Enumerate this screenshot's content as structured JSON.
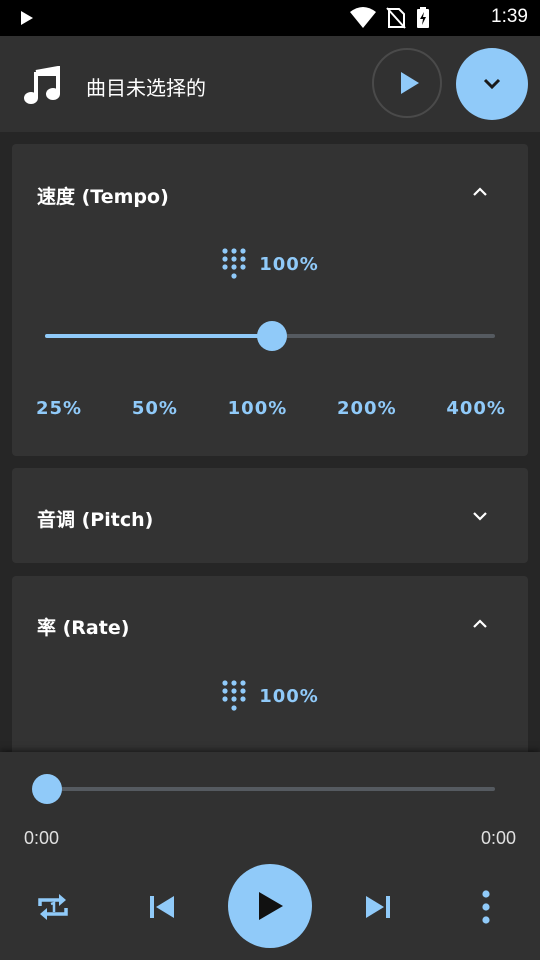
{
  "status_bar": {
    "time": "1:39"
  },
  "header": {
    "track_title": "曲目未选择的"
  },
  "tempo_card": {
    "title": "速度 (Tempo)",
    "value": "100%",
    "slider_position": 0.5,
    "presets": [
      "25%",
      "50%",
      "100%",
      "200%",
      "400%"
    ]
  },
  "pitch_card": {
    "title": "音调 (Pitch)"
  },
  "rate_card": {
    "title": "率 (Rate)",
    "value": "100%"
  },
  "player": {
    "current_time": "0:00",
    "total_time": "0:00",
    "progress": 0
  },
  "colors": {
    "accent": "#90caf9",
    "background": "#262626",
    "card": "#333333"
  },
  "icons": [
    "play-indicator-icon",
    "wifi-icon",
    "no-sim-icon",
    "battery-charging-icon",
    "music-note-icon",
    "play-icon",
    "chevron-down-icon",
    "chevron-up-icon",
    "dialpad-icon",
    "repeat-one-icon",
    "skip-previous-icon",
    "skip-next-icon",
    "more-vert-icon"
  ]
}
